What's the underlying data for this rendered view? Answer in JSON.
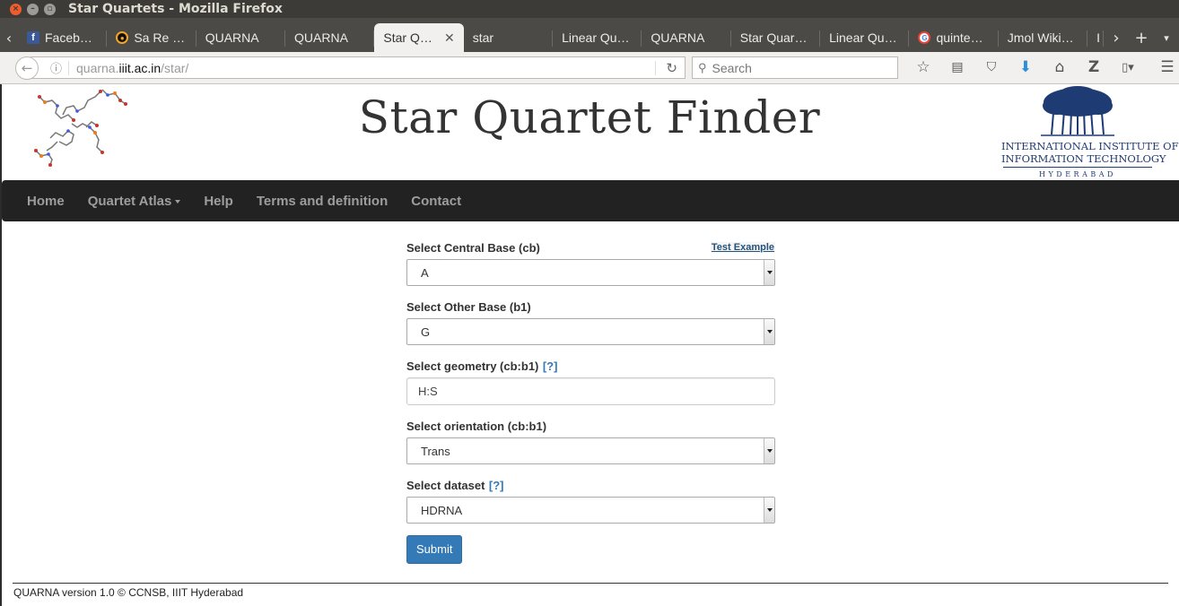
{
  "window": {
    "title": "Star Quartets - Mozilla Firefox"
  },
  "tabs": [
    {
      "label": "Faceb…",
      "icon": "facebook-favicon",
      "active": false
    },
    {
      "label": "Sa Re …",
      "icon": "sa-re-favicon",
      "active": false
    },
    {
      "label": "QUARNA",
      "active": false
    },
    {
      "label": "QUARNA",
      "active": false
    },
    {
      "label": "Star Q…",
      "active": true
    },
    {
      "label": "star",
      "active": false
    },
    {
      "label": "Linear Qu…",
      "active": false
    },
    {
      "label": "QUARNA",
      "active": false
    },
    {
      "label": "Star Quar…",
      "active": false
    },
    {
      "label": "Linear Qu…",
      "active": false
    },
    {
      "label": "quinte…",
      "icon": "google-favicon",
      "active": false
    },
    {
      "label": "Jmol Wiki…",
      "active": false
    },
    {
      "label": "I",
      "active": false
    }
  ],
  "nav": {
    "url_prefix": "quarna.",
    "url_domain": "iiit.ac.in",
    "url_path": "/star/",
    "search_placeholder": "Search"
  },
  "site": {
    "title": "Star Quartet Finder",
    "logo_line1": "INTERNATIONAL INSTITUTE OF",
    "logo_line2": "INFORMATION TECHNOLOGY",
    "logo_line3": "HYDERABAD"
  },
  "menu": {
    "home": "Home",
    "atlas": "Quartet Atlas",
    "help": "Help",
    "terms": "Terms and definition",
    "contact": "Contact"
  },
  "form": {
    "central_base_label": "Select Central Base (cb)",
    "test_example": "Test Example",
    "central_base_value": "A",
    "other_base_label": "Select Other Base (b1)",
    "other_base_value": "G",
    "geometry_label": "Select geometry (cb:b1)",
    "geometry_help": "[?]",
    "geometry_value": "H:S",
    "orientation_label": "Select orientation (cb:b1)",
    "orientation_value": "Trans",
    "dataset_label": "Select dataset",
    "dataset_help": "[?]",
    "dataset_value": "HDRNA",
    "submit": "Submit"
  },
  "footer": {
    "text": "QUARNA version 1.0 © CCNSB, IIIT Hyderabad"
  }
}
